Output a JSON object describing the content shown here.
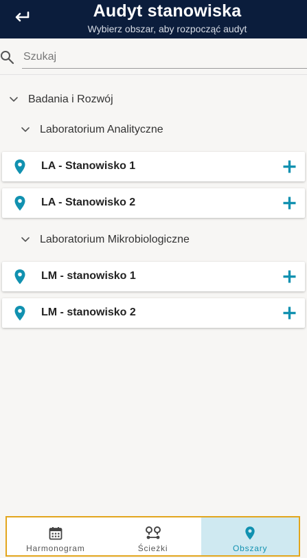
{
  "header": {
    "title": "Audyt stanowiska",
    "subtitle": "Wybierz obszar, aby rozpocząć audyt"
  },
  "search": {
    "placeholder": "Szukaj",
    "value": ""
  },
  "tree": {
    "root": {
      "label": "Badania i Rozwój"
    },
    "groups": [
      {
        "label": "Laboratorium Analityczne",
        "items": [
          {
            "label": "LA - Stanowisko 1"
          },
          {
            "label": "LA - Stanowisko 2"
          }
        ]
      },
      {
        "label": "Laboratorium Mikrobiologiczne",
        "items": [
          {
            "label": "LM - stanowisko 1"
          },
          {
            "label": "LM - stanowisko 2"
          }
        ]
      }
    ]
  },
  "tabs": [
    {
      "label": "Harmonogram",
      "icon": "calendar-icon",
      "active": false
    },
    {
      "label": "Ścieżki",
      "icon": "route-icon",
      "active": false
    },
    {
      "label": "Obszary",
      "icon": "location-pin-icon",
      "active": true
    }
  ],
  "colors": {
    "header_bg": "#0b1d3c",
    "accent": "#1191b0",
    "active_tab_bg": "#cfe9f1",
    "tabbar_border": "#e2a51b"
  }
}
